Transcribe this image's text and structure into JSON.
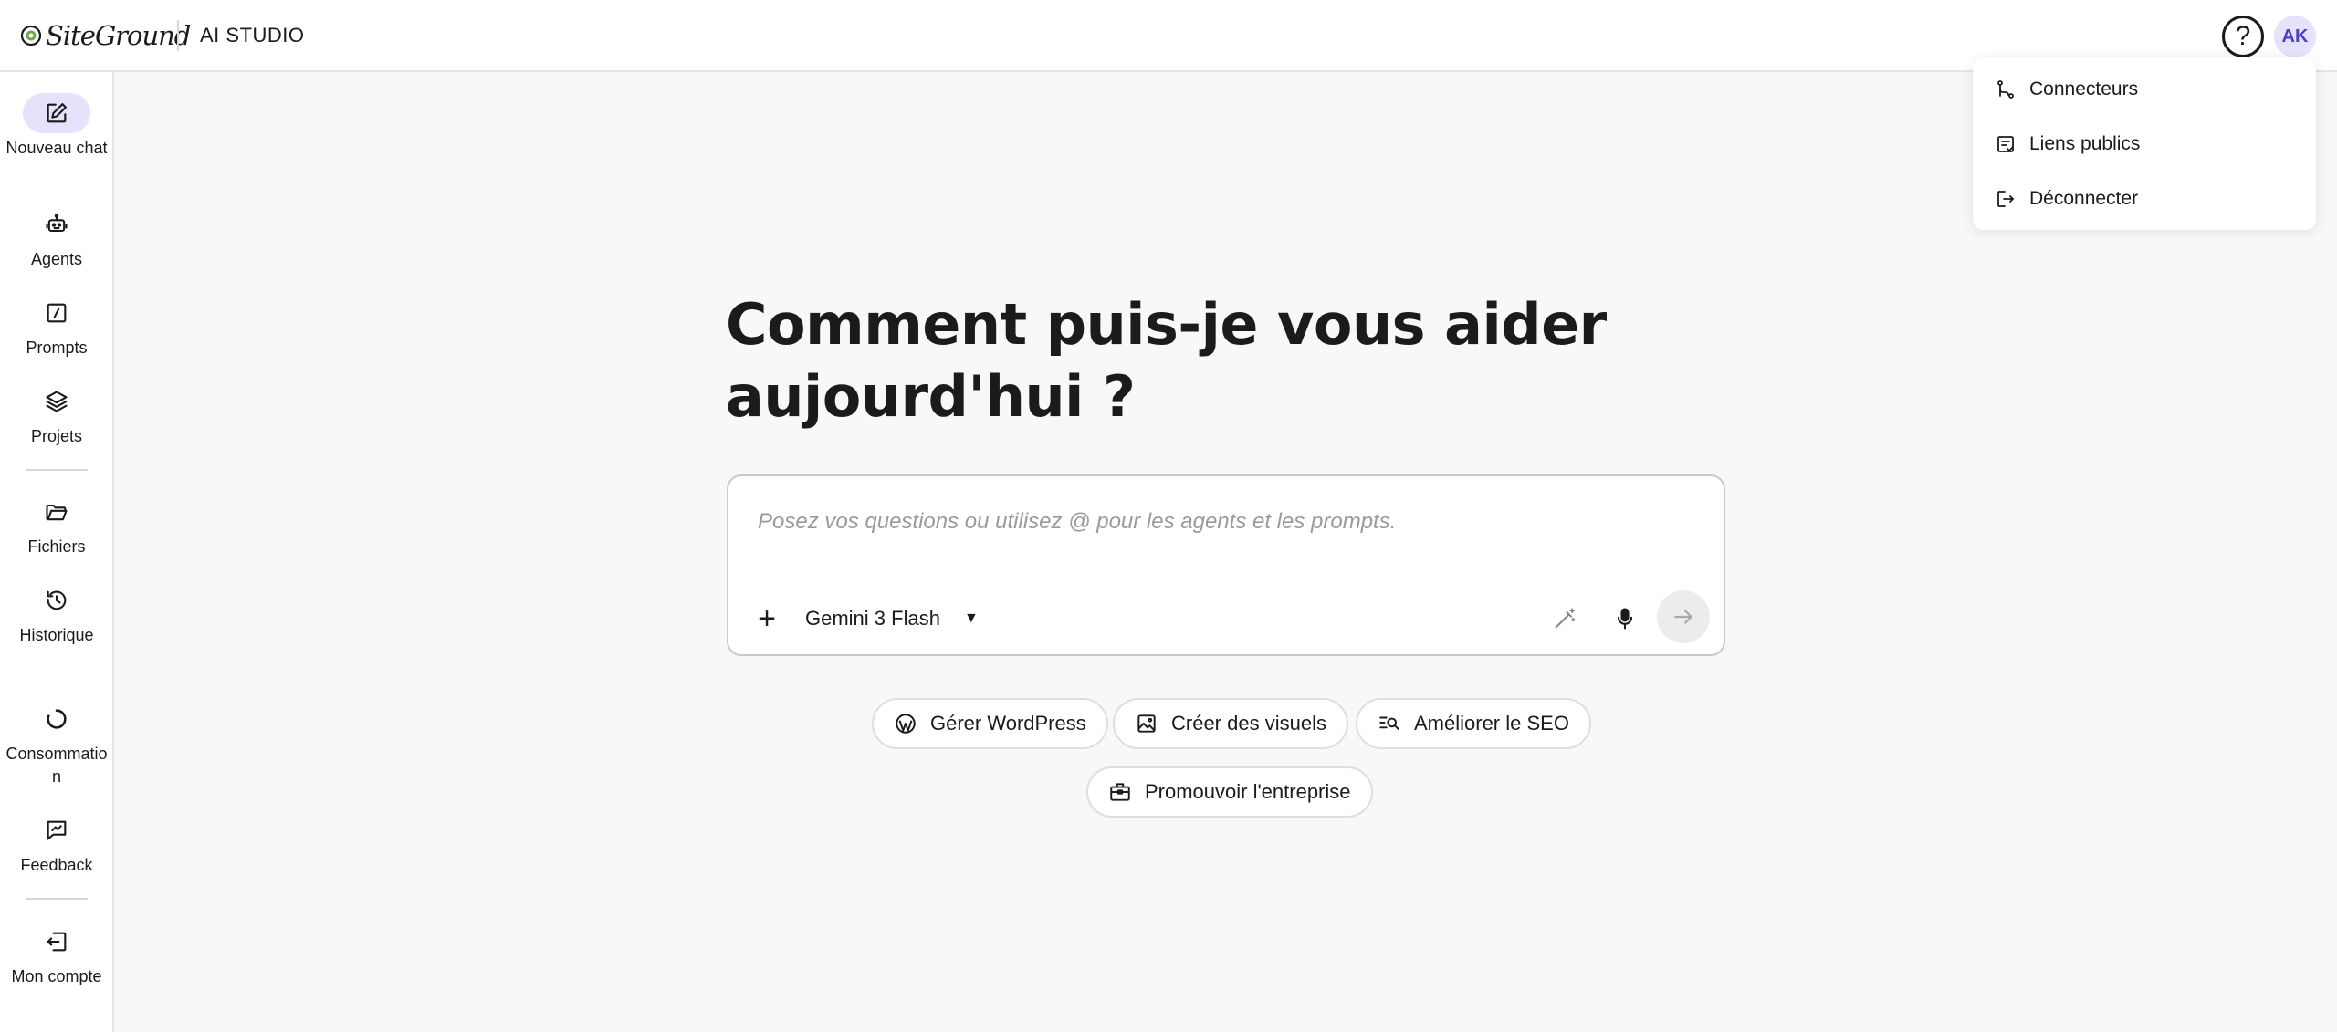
{
  "header": {
    "brand": "SiteGround",
    "app_name": "AI STUDIO",
    "help_icon": "help-circle-icon",
    "avatar_initials": "AK"
  },
  "sidebar": {
    "items": [
      {
        "label": "Nouveau chat",
        "icon": "edit-icon",
        "active": true
      },
      {
        "label": "Agents",
        "icon": "robot-icon"
      },
      {
        "label": "Prompts",
        "icon": "prompt-icon"
      },
      {
        "label": "Projets",
        "icon": "layers-icon"
      },
      {
        "label": "Fichiers",
        "icon": "folder-icon"
      },
      {
        "label": "Historique",
        "icon": "history-icon"
      },
      {
        "label": "Consommation",
        "icon": "usage-circle-icon"
      },
      {
        "label": "Feedback",
        "icon": "feedback-icon"
      },
      {
        "label": "Mon compte",
        "icon": "account-icon"
      }
    ]
  },
  "main": {
    "heading": "Comment puis-je vous aider aujourd'hui ?",
    "composer": {
      "placeholder": "Posez vos questions ou utilisez @ pour les agents et les prompts.",
      "value": "",
      "model": "Gemini 3 Flash"
    },
    "suggestions": [
      {
        "label": "Gérer WordPress",
        "icon": "wordpress-icon"
      },
      {
        "label": "Créer des visuels",
        "icon": "image-icon"
      },
      {
        "label": "Améliorer le SEO",
        "icon": "search-list-icon"
      },
      {
        "label": "Promouvoir l'entreprise",
        "icon": "briefcase-icon"
      }
    ]
  },
  "account_menu": {
    "items": [
      {
        "label": "Connecteurs",
        "icon": "connector-icon"
      },
      {
        "label": "Liens publics",
        "icon": "public-link-icon"
      },
      {
        "label": "Déconnecter",
        "icon": "logout-icon"
      }
    ]
  },
  "colors": {
    "accent_light": "#e6e2fb",
    "accent_text": "#4c3fc7",
    "brand_green": "#6aa84f"
  }
}
